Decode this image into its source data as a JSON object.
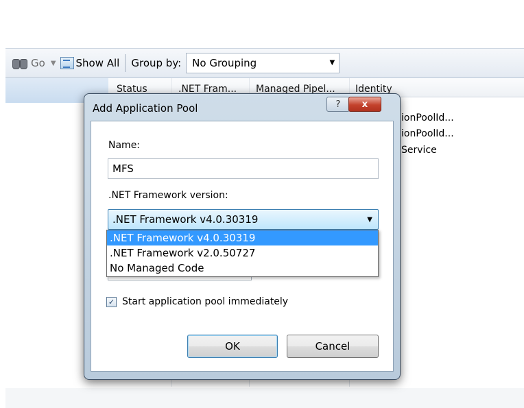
{
  "toolbar": {
    "go_label": "Go",
    "show_all_label": "Show All",
    "group_by_label": "Group by:",
    "grouping_value": "No Grouping"
  },
  "grid": {
    "columns": [
      "Status",
      ".NET Fram...",
      "Managed Pipel...",
      "Identity"
    ],
    "identity_values": [
      "ionPoolId...",
      "ionPoolId...",
      "Service"
    ]
  },
  "dialog": {
    "title": "Add Application Pool",
    "help_label": "?",
    "close_label": "x",
    "name_label": "Name:",
    "name_value": "MFS",
    "framework_label": ".NET Framework version:",
    "framework_selected": ".NET Framework v4.0.30319",
    "framework_options": [
      ".NET Framework v4.0.30319",
      ".NET Framework v2.0.50727",
      "No Managed Code"
    ],
    "start_immediately_label": "Start application pool immediately",
    "start_immediately_checked": true,
    "ok_label": "OK",
    "cancel_label": "Cancel"
  }
}
